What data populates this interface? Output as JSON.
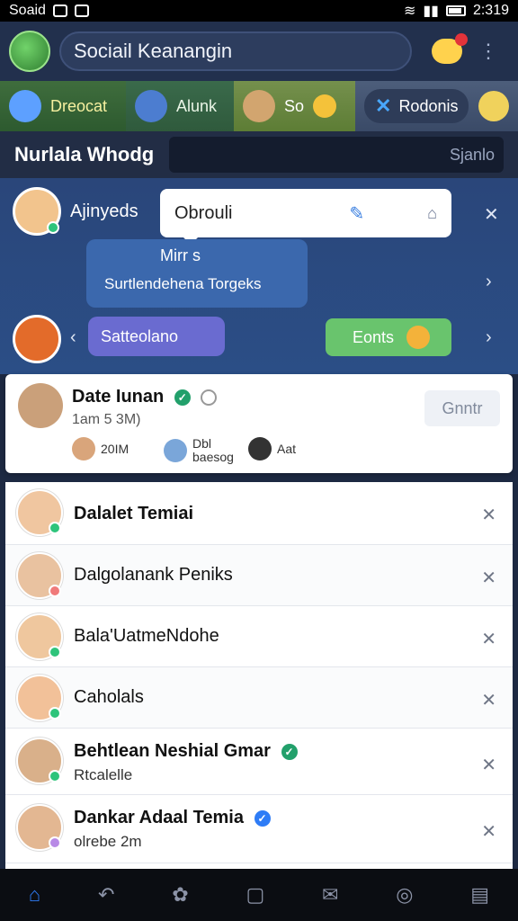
{
  "status_bar": {
    "left_label": "Soaid",
    "time": "2:319"
  },
  "app": {
    "search_title": "Sociail Keanangin"
  },
  "channels": [
    {
      "label": "Dreocat"
    },
    {
      "label": "Alunk"
    },
    {
      "label": "So"
    },
    {
      "label": "Rodonis"
    }
  ],
  "section": {
    "title": "Nurlala Whodg",
    "search_placeholder": "Sjanlo"
  },
  "chat": {
    "sender": "Ajinyeds",
    "popup_text": "Obrouli",
    "bubble_line1": "Mirr s",
    "bubble_line2": "Surtlendehena Torgeks",
    "purple_pill": "Satteolano",
    "green_pill": "Eonts"
  },
  "card": {
    "name": "Date Iunan",
    "time": "1am 5 3M)",
    "action_label": "Gnntr",
    "reactors": [
      {
        "label": "20IM"
      },
      {
        "label": "Dbl\nbaesog"
      },
      {
        "label": "Aat"
      }
    ]
  },
  "list": [
    {
      "name": "Dalalet Temiai",
      "sub": ""
    },
    {
      "name": "Dalgolanank Peniks",
      "sub": ""
    },
    {
      "name": "Bala'UatmeNdohe",
      "sub": ""
    },
    {
      "name": "Caholals",
      "sub": ""
    },
    {
      "name": "Behtlean Neshial Gmar",
      "sub": "Rtcalelle"
    },
    {
      "name": "Dankar Adaal Temia",
      "sub": "olrebe 2m"
    }
  ],
  "colors": {
    "accent": "#2e7cf6",
    "green_status": "#22a06b",
    "green_button": "#69c46d",
    "purple_pill": "#6a6bd0"
  }
}
